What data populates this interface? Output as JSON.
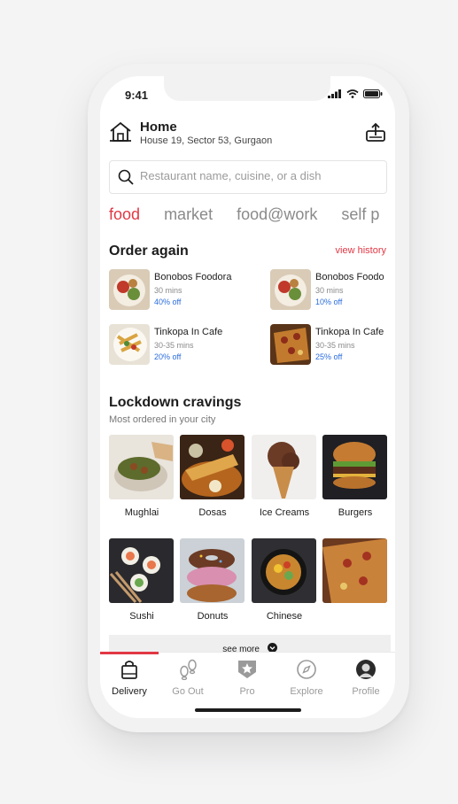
{
  "status_bar": {
    "time": "9:41"
  },
  "location": {
    "title": "Home",
    "address": "House 19, Sector 53, Gurgaon"
  },
  "search": {
    "placeholder": "Restaurant name, cuisine, or a dish"
  },
  "tabs": [
    {
      "label": "food",
      "active": true
    },
    {
      "label": "market",
      "active": false
    },
    {
      "label": "food@work",
      "active": false
    },
    {
      "label": "self p",
      "active": false
    }
  ],
  "order_again": {
    "title": "Order again",
    "view_history": "view history",
    "items": [
      {
        "name": "Bonobos Foodora",
        "time": "30 mins",
        "offer": "40% off"
      },
      {
        "name": "Bonobos Foodo",
        "time": "30 mins",
        "offer": "10% off"
      },
      {
        "name": "Tinkopa In Cafe",
        "time": "30-35 mins",
        "offer": "20% off"
      },
      {
        "name": "Tinkopa In Cafe",
        "time": "30-35 mins",
        "offer": "25% off"
      }
    ]
  },
  "cravings": {
    "title": "Lockdown cravings",
    "subtitle": "Most ordered in your city",
    "items": [
      {
        "label": "Mughlai"
      },
      {
        "label": "Dosas"
      },
      {
        "label": "Ice Creams"
      },
      {
        "label": "Burgers"
      },
      {
        "label": "Sushi"
      },
      {
        "label": "Donuts"
      },
      {
        "label": "Chinese"
      },
      {
        "label": ""
      }
    ],
    "see_more": "see more"
  },
  "bottom_nav": [
    {
      "label": "Delivery",
      "icon": "shopping-bag-icon",
      "active": true
    },
    {
      "label": "Go Out",
      "icon": "footprints-icon",
      "active": false
    },
    {
      "label": "Pro",
      "icon": "pro-badge-icon",
      "active": false
    },
    {
      "label": "Explore",
      "icon": "compass-icon",
      "active": false
    },
    {
      "label": "Profile",
      "icon": "avatar-icon",
      "active": false
    }
  ],
  "colors": {
    "accent": "#e23744",
    "offer": "#2b6cdd",
    "muted": "#8a8a8a"
  }
}
